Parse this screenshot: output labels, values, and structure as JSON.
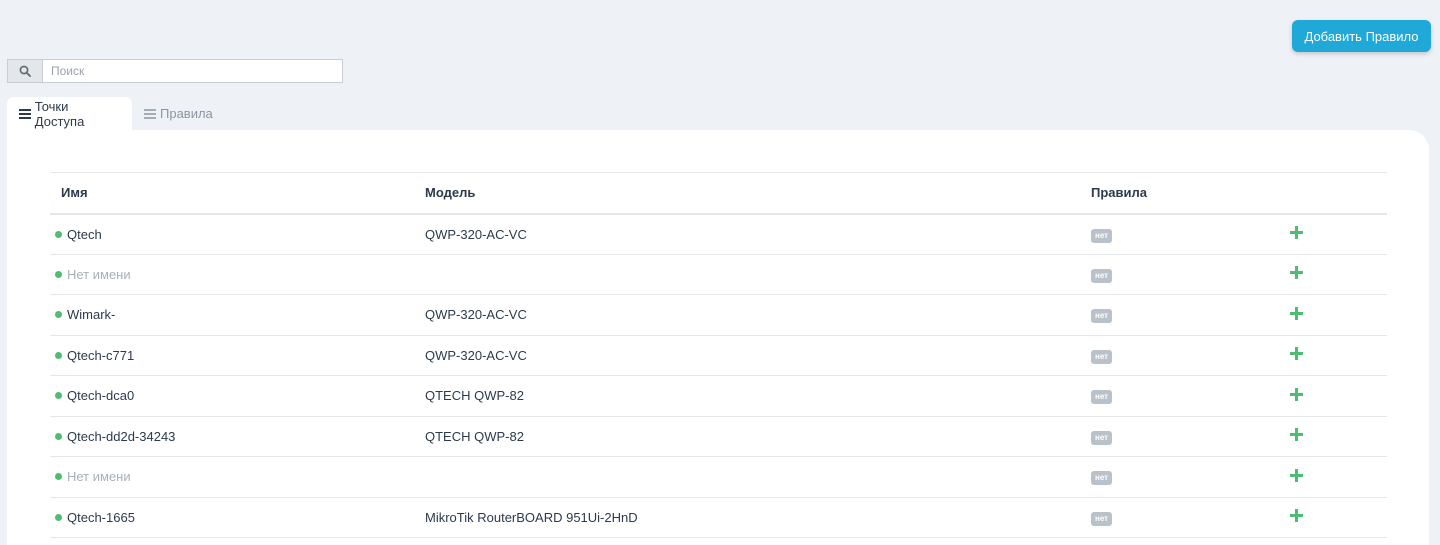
{
  "header": {
    "add_rule_label": "Добавить Правило"
  },
  "search": {
    "placeholder": "Поиск",
    "value": ""
  },
  "tabs": [
    {
      "label": "Точки Доступа",
      "active": true
    },
    {
      "label": "Правила",
      "active": false
    }
  ],
  "table": {
    "columns": [
      "Имя",
      "Модель",
      "Правила",
      ""
    ],
    "rows": [
      {
        "name": "Qtech",
        "named": true,
        "model": "QWP-320-AC-VC",
        "rules": "нет"
      },
      {
        "name": "Нет имени",
        "named": false,
        "model": "",
        "rules": "нет"
      },
      {
        "name": "Wimark-",
        "named": true,
        "model": "QWP-320-AC-VC",
        "rules": "нет"
      },
      {
        "name": "Qtech-c771",
        "named": true,
        "model": "QWP-320-AC-VC",
        "rules": "нет"
      },
      {
        "name": "Qtech-dca0",
        "named": true,
        "model": "QTECH QWP-82",
        "rules": "нет"
      },
      {
        "name": "Qtech-dd2d-34243",
        "named": true,
        "model": "QTECH QWP-82",
        "rules": "нет"
      },
      {
        "name": "Нет имени",
        "named": false,
        "model": "",
        "rules": "нет"
      },
      {
        "name": "Qtech-1665",
        "named": true,
        "model": "MikroTik RouterBOARD 951Ui-2HnD",
        "rules": "нет"
      }
    ]
  },
  "icons": {
    "search": "search-icon",
    "tab": "menu-icon",
    "add": "plus-icon"
  },
  "colors": {
    "accent": "#20a8d8",
    "status_online": "#4dbd74",
    "badge": "#b9c1ca"
  }
}
